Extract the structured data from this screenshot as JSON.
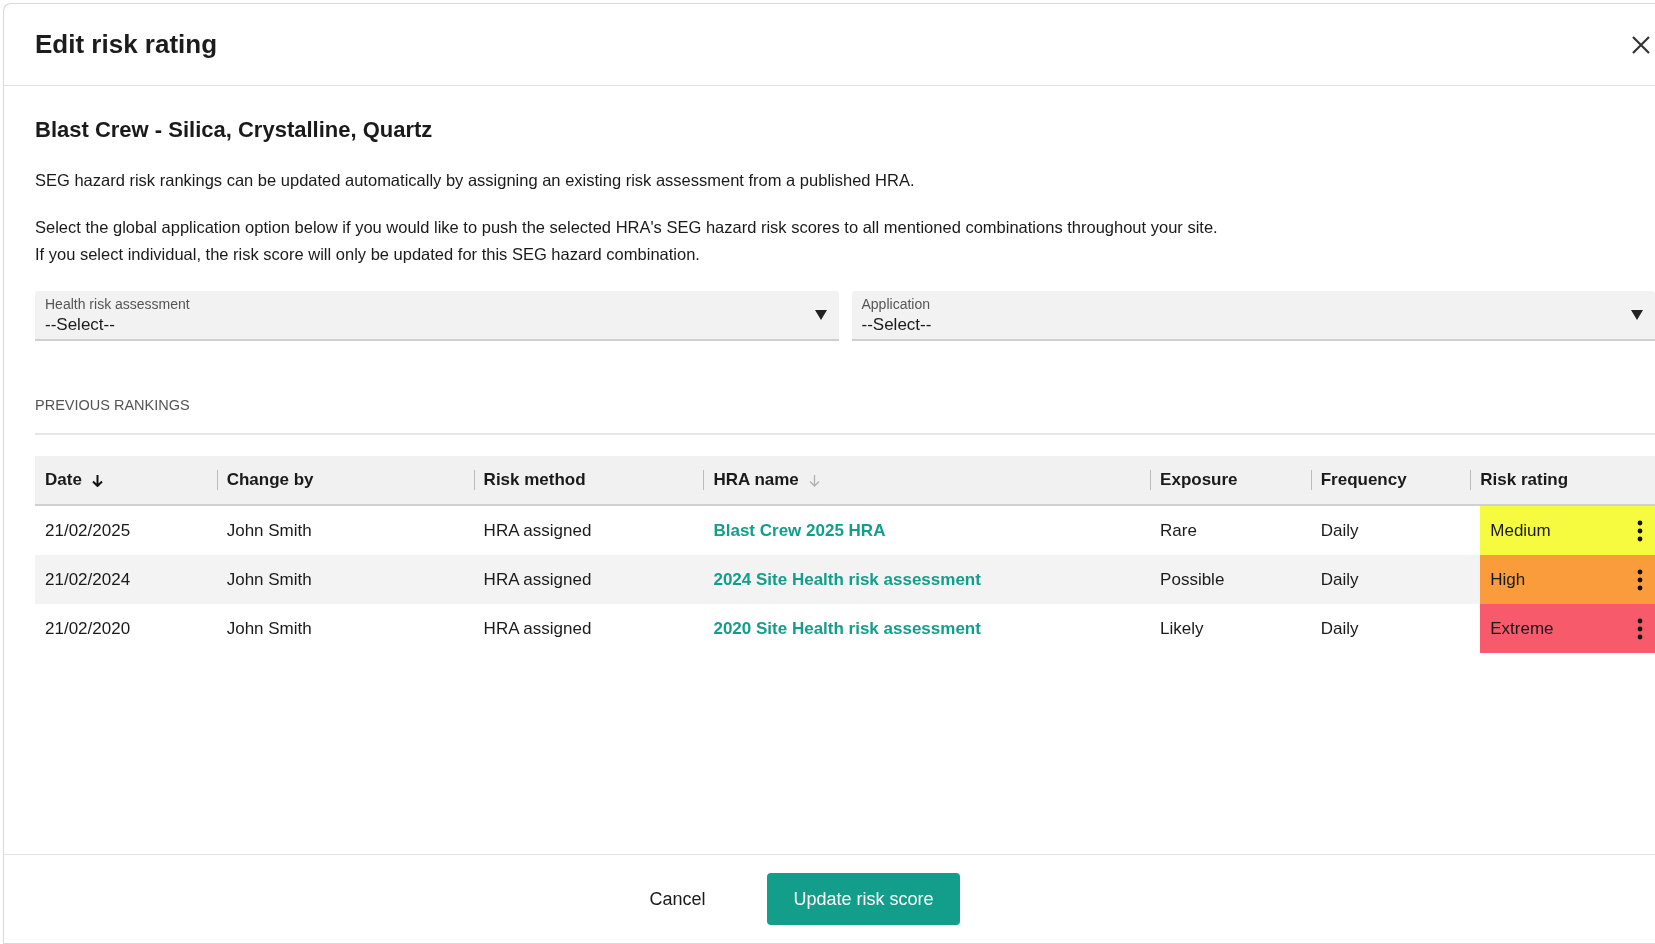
{
  "dialog": {
    "title": "Edit risk rating"
  },
  "subtitle": "Blast Crew - Silica, Crystalline, Quartz",
  "intro": "SEG hazard risk rankings can be updated automatically by assigning an existing risk assessment from a published HRA.",
  "note_lines": [
    "Select the global application option below if you would like to push the selected HRA's SEG hazard risk scores to all mentioned combinations throughout your site.",
    "If you select individual, the risk score will only be updated for this SEG hazard combination."
  ],
  "fields": [
    {
      "label": "Health risk assessment",
      "value": "--Select--"
    },
    {
      "label": "Application",
      "value": "--Select--"
    }
  ],
  "section_label": "PREVIOUS RANKINGS",
  "table": {
    "columns": [
      {
        "label": "Date",
        "sorted": true
      },
      {
        "label": "Change by"
      },
      {
        "label": "Risk method"
      },
      {
        "label": "HRA name",
        "sorted": false
      },
      {
        "label": "Exposure"
      },
      {
        "label": "Frequency"
      },
      {
        "label": "Risk rating"
      }
    ],
    "rows": [
      {
        "date": "21/02/2025",
        "change_by": "John Smith",
        "risk_method": "HRA assigned",
        "hra_name": "Blast Crew 2025 HRA",
        "exposure": "Rare",
        "frequency": "Daily",
        "risk_rating": "Medium",
        "color": "#f6fb3f"
      },
      {
        "date": "21/02/2024",
        "change_by": "John Smith",
        "risk_method": "HRA assigned",
        "hra_name": "2024 Site Health risk assessment",
        "exposure": "Possible",
        "frequency": "Daily",
        "risk_rating": "High",
        "color": "#fa9b3c"
      },
      {
        "date": "21/02/2020",
        "change_by": "John Smith",
        "risk_method": "HRA assigned",
        "hra_name": "2020 Site Health risk assessment",
        "exposure": "Likely",
        "frequency": "Daily",
        "risk_rating": "Extreme",
        "color": "#f65a6b"
      }
    ]
  },
  "buttons": [
    {
      "label": "Cancel",
      "kind": "text"
    },
    {
      "label": "Update risk score",
      "kind": "primary"
    }
  ]
}
